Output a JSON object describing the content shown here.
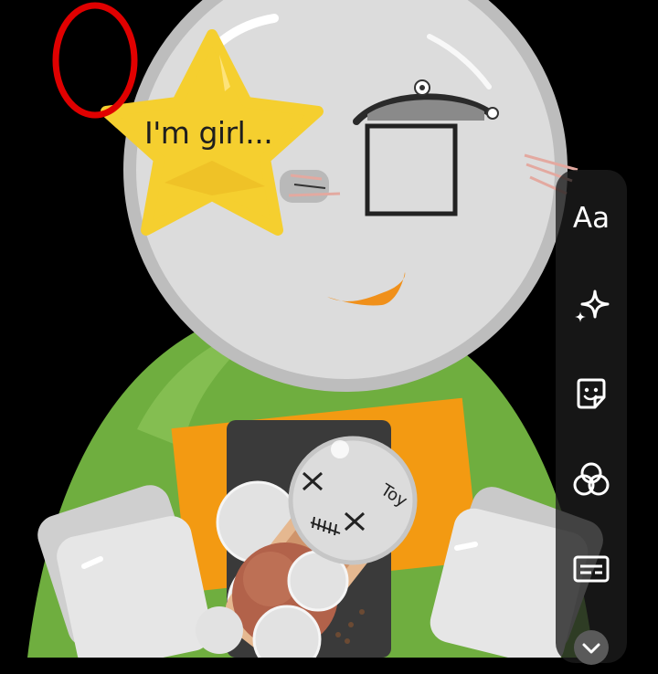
{
  "sticker_text": "I'm girl...",
  "doll_tag": "Toy",
  "toolbar": {
    "items": [
      {
        "name": "text-tool",
        "label": "Aa",
        "icon": "text-icon"
      },
      {
        "name": "effects-tool",
        "label": "",
        "icon": "sparkle-icon"
      },
      {
        "name": "sticker-tool",
        "label": "",
        "icon": "sticker-icon"
      },
      {
        "name": "filter-tool",
        "label": "",
        "icon": "filter-circles-icon"
      },
      {
        "name": "caption-tool",
        "label": "",
        "icon": "caption-icon"
      },
      {
        "name": "collapse-tool",
        "label": "",
        "icon": "chevron-down-icon"
      }
    ]
  },
  "colors": {
    "background": "#000000",
    "head": "#dcdcdc",
    "body": "#6fae3f",
    "star": "#f5cf2f",
    "red_marker": "#e00000",
    "orange_square": "#f39a12"
  }
}
